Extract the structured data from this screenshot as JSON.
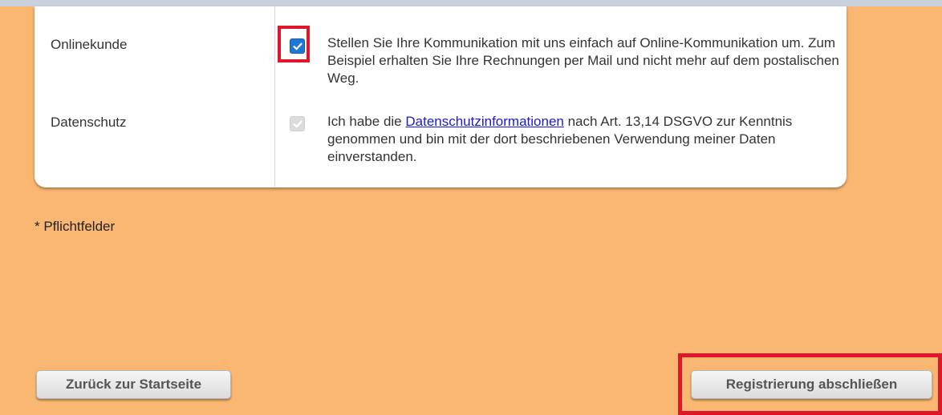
{
  "form": {
    "online_label": "Onlinekunde",
    "online_text": "Stellen Sie Ihre Kommunikation mit uns einfach auf Online-Kommunikation um. Zum Beispiel erhalten Sie Ihre Rechnungen per Mail und nicht mehr auf dem postalischen Weg.",
    "online_checked": true,
    "privacy_label": "Datenschutz",
    "privacy_text_before": "Ich habe die ",
    "privacy_link": "Datenschutzinformationen",
    "privacy_text_after": " nach Art. 13,14 DSGVO zur Kenntnis genommen und bin mit der dort beschriebenen Verwendung meiner Daten einverstanden.",
    "privacy_checked": true
  },
  "required_note": "* Pflichtfelder",
  "buttons": {
    "back": "Zurück zur Startseite",
    "finish": "Registrierung abschließen"
  },
  "colors": {
    "background": "#f9b772",
    "highlight": "#e0162b",
    "checkbox_checked": "#1e78d4",
    "link": "#1a1ad6"
  },
  "icons": {
    "online_checkbox": "check-icon",
    "privacy_checkbox": "check-icon"
  }
}
